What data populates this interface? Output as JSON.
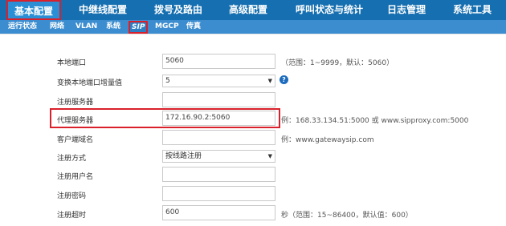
{
  "topnav": {
    "items": [
      "基本配置",
      "中继线配置",
      "拨号及路由",
      "高级配置",
      "呼叫状态与统计",
      "日志管理",
      "系统工具"
    ]
  },
  "subnav": {
    "items": [
      "运行状态",
      "网络",
      "VLAN",
      "系统",
      "SIP",
      "MGCP",
      "传真"
    ]
  },
  "form": {
    "local_port": {
      "label": "本地端口",
      "value": "5060",
      "hint": "（范围：1~9999，默认：5060）"
    },
    "port_increment": {
      "label": "变换本地端口增量值",
      "value": "5",
      "help_icon": "?"
    },
    "register_server": {
      "label": "注册服务器",
      "value": ""
    },
    "proxy_server": {
      "label": "代理服务器",
      "value": "172.16.90.2:5060",
      "hint": "例：168.33.134.51:5000 或 www.sipproxy.com:5000"
    },
    "client_domain": {
      "label": "客户端域名",
      "value": "",
      "hint": "例：www.gatewaysip.com"
    },
    "register_mode": {
      "label": "注册方式",
      "value": "按线路注册"
    },
    "register_user": {
      "label": "注册用户名",
      "value": ""
    },
    "register_password": {
      "label": "注册密码",
      "value": ""
    },
    "register_timeout": {
      "label": "注册超时",
      "value": "600",
      "hint": "秒（范围：15~86400，默认值：600）"
    }
  },
  "colors": {
    "topnav_bg": "#166fb0",
    "subnav_bg": "#3b8dd0",
    "highlight": "#d9202b"
  }
}
